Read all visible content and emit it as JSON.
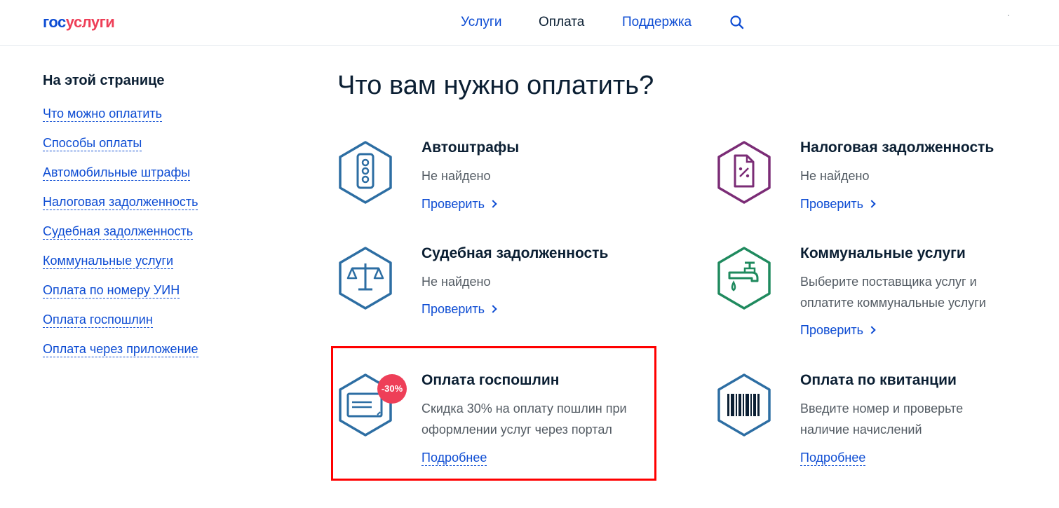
{
  "header": {
    "logo_part1": "гос",
    "logo_part2": "услуги",
    "nav": [
      "Услуги",
      "Оплата",
      "Поддержка"
    ],
    "search_icon": "search-icon"
  },
  "sidebar": {
    "title": "На этой странице",
    "links": [
      "Что можно оплатить",
      "Способы оплаты",
      "Автомобильные штрафы",
      "Налоговая задолженность",
      "Судебная задолженность",
      "Коммунальные услуги",
      "Оплата по номеру УИН",
      "Оплата госпошлин",
      "Оплата через приложение"
    ]
  },
  "main": {
    "title": "Что вам нужно оплатить?",
    "cards": [
      {
        "title": "Автоштрафы",
        "text": "Не найдено",
        "link": "Проверить",
        "icon": "traffic-light-icon",
        "color": "#2d6ea3"
      },
      {
        "title": "Налоговая задолженность",
        "text": "Не найдено",
        "link": "Проверить",
        "icon": "tax-document-icon",
        "color": "#7b2c76"
      },
      {
        "title": "Судебная задолженность",
        "text": "Не найдено",
        "link": "Проверить",
        "icon": "scales-icon",
        "color": "#2d6ea3"
      },
      {
        "title": "Коммунальные услуги",
        "text1": "Выберите поставщика услуг и",
        "text2": "оплатите коммунальные услуги",
        "link": "Проверить",
        "icon": "water-tap-icon",
        "color": "#1f8a5e"
      },
      {
        "title": "Оплата госпошлин",
        "text1": "Скидка 30% на оплату пошлин при",
        "text2": "оформлении услуг через портал",
        "link": "Подробнее",
        "badge": "-30%",
        "icon": "receipt-icon",
        "color": "#2d6ea3"
      },
      {
        "title": "Оплата по квитанции",
        "text1": "Введите номер и проверьте",
        "text2": "наличие начислений",
        "link": "Подробнее",
        "icon": "barcode-icon",
        "color": "#2d6ea3"
      }
    ]
  },
  "colors": {
    "accent": "#0d4cd3",
    "brand_red": "#ee3f58",
    "highlight": "#ff0000"
  }
}
